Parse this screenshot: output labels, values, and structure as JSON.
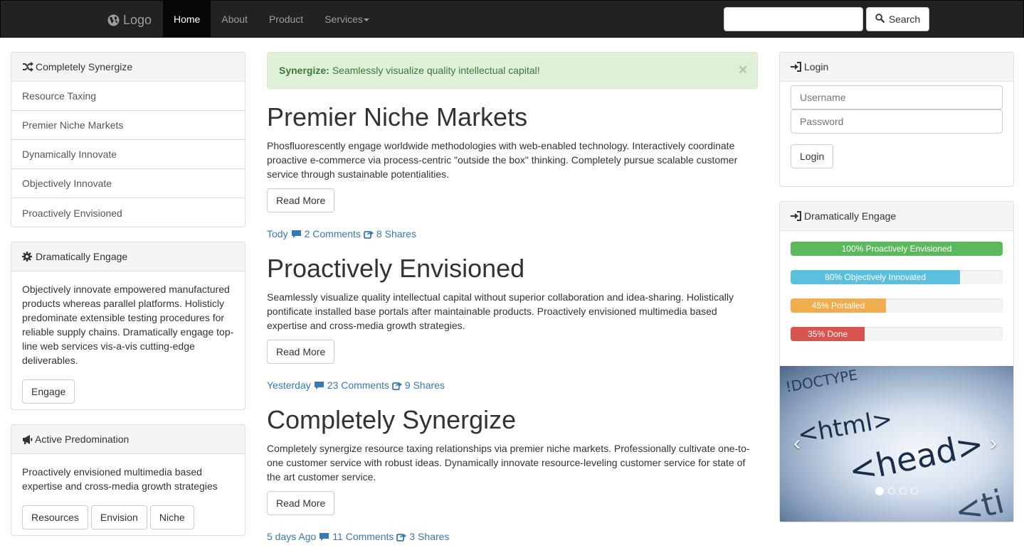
{
  "navbar": {
    "brand_label": "Logo",
    "brand_icon": "globe-icon",
    "items": [
      {
        "label": "Home",
        "active": true
      },
      {
        "label": "About"
      },
      {
        "label": "Product"
      },
      {
        "label": "Services"
      }
    ],
    "search_value": "",
    "search_button_label": "Search"
  },
  "left": {
    "panel1": {
      "title": "Completely Synergize",
      "icon": "shuffle-icon",
      "items": [
        "Resource Taxing",
        "Premier Niche Markets",
        "Dynamically Innovate",
        "Objectively Innovate",
        "Proactively Envisioned"
      ]
    },
    "panel2": {
      "title": "Dramatically Engage",
      "icon": "gear-icon",
      "body": "Objectively innovate empowered manufactured products whereas parallel platforms. Holisticly predominate extensible testing procedures for reliable supply chains. Dramatically engage top-line web services vis-a-vis cutting-edge deliverables.",
      "button": "Engage"
    },
    "panel3": {
      "title": "Active Predomination",
      "icon": "bullhorn-icon",
      "body": "Proactively envisioned multimedia based expertise and cross-media growth strategies",
      "buttons": [
        "Resources",
        "Envision",
        "Niche"
      ]
    }
  },
  "alert": {
    "strong": "Synergize:",
    "text": "Seamlessly visualize quality intellectual capital!",
    "close": "×"
  },
  "articles": [
    {
      "title": "Premier Niche Markets",
      "body": "Phosfluorescently engage worldwide methodologies with web-enabled technology. Interactively coordinate proactive e-commerce via process-centric \"outside the box\" thinking. Completely pursue scalable customer service through sustainable potentialities.",
      "button": "Read More",
      "date": "Tody",
      "comments": "2 Comments",
      "shares": "8 Shares"
    },
    {
      "title": "Proactively Envisioned",
      "body": "Seamlessly visualize quality intellectual capital without superior collaboration and idea-sharing. Holistically pontificate installed base portals after maintainable products. Proactively envisioned multimedia based expertise and cross-media growth strategies.",
      "button": "Read More",
      "date": "Yesterday",
      "comments": "23 Comments",
      "shares": "9 Shares"
    },
    {
      "title": "Completely Synergize",
      "body": "Completely synergize resource taxing relationships via premier niche markets. Professionally cultivate one-to-one customer service with robust ideas. Dynamically innovate resource-leveling customer service for state of the art customer service.",
      "button": "Read More",
      "date": "5 days Ago",
      "comments": "11 Comments",
      "shares": "3 Shares"
    }
  ],
  "right": {
    "login": {
      "title": "Login",
      "icon": "login-icon",
      "username_placeholder": "Username",
      "password_placeholder": "Password",
      "button": "Login"
    },
    "engage": {
      "title": "Dramatically Engage",
      "icon": "login-icon",
      "progress": [
        {
          "label": "100% Proactively Envisioned",
          "percent": 100,
          "color": "#5cb85c"
        },
        {
          "label": "80% Objectively Innovated",
          "percent": 80,
          "color": "#5bc0de"
        },
        {
          "label": "45% Portalled",
          "percent": 45,
          "color": "#f0ad4e"
        },
        {
          "label": "35% Done",
          "percent": 35,
          "color": "#d9534f"
        }
      ]
    },
    "carousel": {
      "slides": 4,
      "active": 0,
      "prev": "‹",
      "next": "›",
      "image_text": [
        "!DOCTYPE",
        "<html>",
        "<head>",
        "<ti"
      ]
    }
  }
}
